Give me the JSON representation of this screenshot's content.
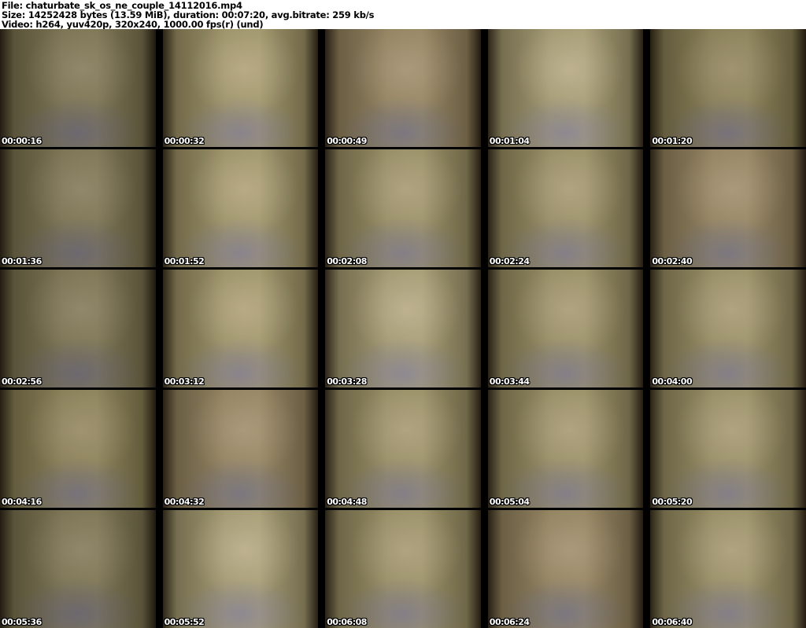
{
  "header": {
    "file": "File: chaturbate_sk_os_ne_couple_14112016.mp4",
    "size": "Size: 14252428 bytes (13.59 MiB), duration: 00:07:20, avg.bitrate: 259 kb/s",
    "video": "Video: h264, yuv420p, 320x240, 1000.00 fps(r) (und)"
  },
  "grid": {
    "columns": 5,
    "rows": 5,
    "thumbnails": [
      {
        "timestamp": "00:00:16"
      },
      {
        "timestamp": "00:00:32"
      },
      {
        "timestamp": "00:00:49"
      },
      {
        "timestamp": "00:01:04"
      },
      {
        "timestamp": "00:01:20"
      },
      {
        "timestamp": "00:01:36"
      },
      {
        "timestamp": "00:01:52"
      },
      {
        "timestamp": "00:02:08"
      },
      {
        "timestamp": "00:02:24"
      },
      {
        "timestamp": "00:02:40"
      },
      {
        "timestamp": "00:02:56"
      },
      {
        "timestamp": "00:03:12"
      },
      {
        "timestamp": "00:03:28"
      },
      {
        "timestamp": "00:03:44"
      },
      {
        "timestamp": "00:04:00"
      },
      {
        "timestamp": "00:04:16"
      },
      {
        "timestamp": "00:04:32"
      },
      {
        "timestamp": "00:04:48"
      },
      {
        "timestamp": "00:05:04"
      },
      {
        "timestamp": "00:05:20"
      },
      {
        "timestamp": "00:05:36"
      },
      {
        "timestamp": "00:05:52"
      },
      {
        "timestamp": "00:06:08"
      },
      {
        "timestamp": "00:06:24"
      },
      {
        "timestamp": "00:06:40"
      }
    ]
  },
  "colors": {
    "header_bg": "#ffffff",
    "header_text": "#000000",
    "grid_bg": "#000000",
    "timestamp_text": "#ffffff",
    "scene_base": "#958c64",
    "scene_shadow": "#2a2316",
    "scene_accent": "#6868ba"
  }
}
